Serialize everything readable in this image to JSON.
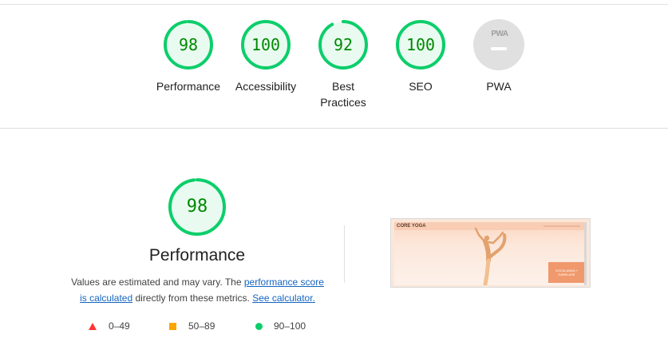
{
  "summary_gauges": [
    {
      "label": "Performance",
      "score": "98",
      "value": 0.98,
      "color": "#0cce6b"
    },
    {
      "label": "Accessibility",
      "score": "100",
      "value": 1.0,
      "color": "#0cce6b"
    },
    {
      "label": "Best Practices",
      "label_lines": [
        "Best",
        "Practices"
      ],
      "score": "92",
      "value": 0.92,
      "color": "#0cce6b"
    },
    {
      "label": "SEO",
      "score": "100",
      "value": 1.0,
      "color": "#0cce6b"
    },
    {
      "label": "PWA",
      "badge": "PWA",
      "color": "#e0e0e0"
    }
  ],
  "performance": {
    "score": "98",
    "value": 0.98,
    "title": "Performance",
    "desc_prefix": "Values are estimated and may vary. The ",
    "link_score": "performance score",
    "link_calc": "is calculated",
    "desc_middle": " directly from these metrics. ",
    "link_calculator": "See calculator."
  },
  "legend": [
    {
      "range": "0–49",
      "icon": "triangle-icon",
      "color": "#ff3333"
    },
    {
      "range": "50–89",
      "icon": "square-icon",
      "color": "#ffa400"
    },
    {
      "range": "90–100",
      "icon": "circle-icon",
      "color": "#0cce6b"
    }
  ],
  "screenshot": {
    "brand": "CORE YOGA",
    "card_text": "SOCALANDA + KARELASE"
  }
}
